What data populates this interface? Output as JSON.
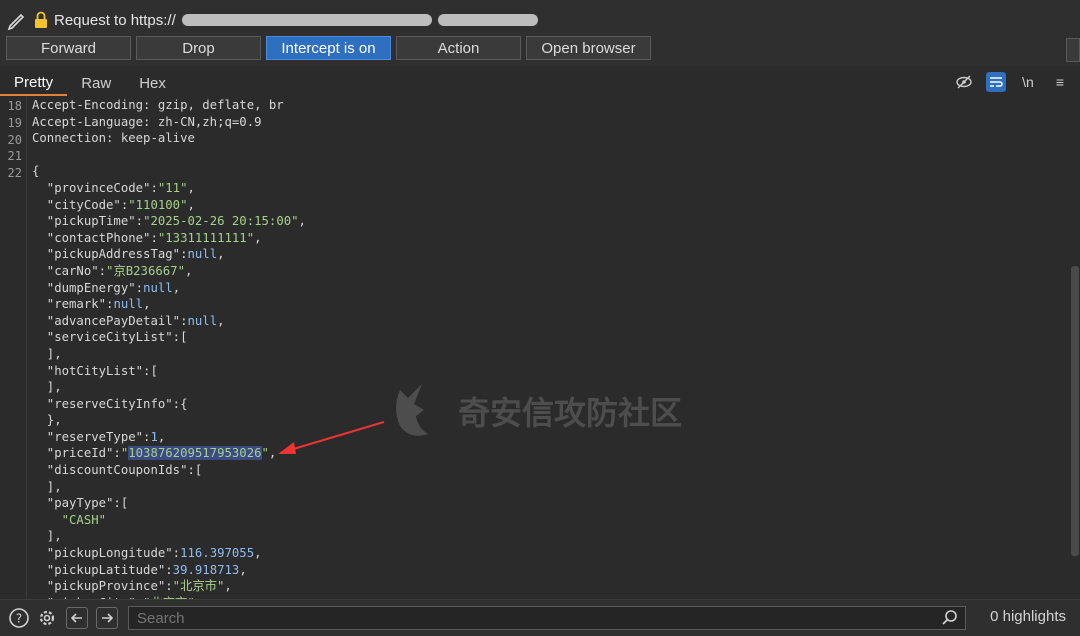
{
  "request": {
    "label": "Request to https://"
  },
  "toolbar": {
    "forward": "Forward",
    "drop": "Drop",
    "intercept": "Intercept is on",
    "action": "Action",
    "open_browser": "Open browser"
  },
  "tabs": [
    "Pretty",
    "Raw",
    "Hex"
  ],
  "tools": {
    "no_reveal": "eye-off-icon",
    "wrap": "wrap-icon",
    "newline": "\\n",
    "menu": "≡"
  },
  "editor": {
    "line_numbers": [
      "18",
      "19",
      "20",
      "21",
      "22"
    ],
    "lines": [
      "Accept-Encoding: gzip, deflate, br",
      "Accept-Language: zh-CN,zh;q=0.9",
      "Connection: keep-alive",
      "",
      "{",
      "  \"provinceCode\":\"11\",",
      "  \"cityCode\":\"110100\",",
      "  \"pickupTime\":\"2025-02-26 20:15:00\",",
      "  \"contactPhone\":\"13311111111\",",
      "  \"pickupAddressTag\":null,",
      "  \"carNo\":\"京B236667\",",
      "  \"dumpEnergy\":null,",
      "  \"remark\":null,",
      "  \"advancePayDetail\":null,",
      "  \"serviceCityList\":[",
      "  ],",
      "  \"hotCityList\":[",
      "  ],",
      "  \"reserveCityInfo\":{",
      "  },",
      "  \"reserveType\":1,",
      "  \"priceId\":\"103876209517953026\",",
      "  \"discountCouponIds\":[",
      "  ],",
      "  \"payType\":[",
      "    \"CASH\"",
      "  ],",
      "  \"pickupLongitude\":116.397055,",
      "  \"pickupLatitude\":39.918713,",
      "  \"pickupProvince\":\"北京市\",",
      "  \"pickupCity\":\"北京市\","
    ]
  },
  "watermark": "奇安信攻防社区",
  "status": {
    "search_placeholder": "Search",
    "highlights": "0 highlights"
  },
  "colors": {
    "accent": "#2f6fbf",
    "tab_underline": "#e0813a",
    "string": "#a6d189",
    "number": "#8fbcef"
  }
}
